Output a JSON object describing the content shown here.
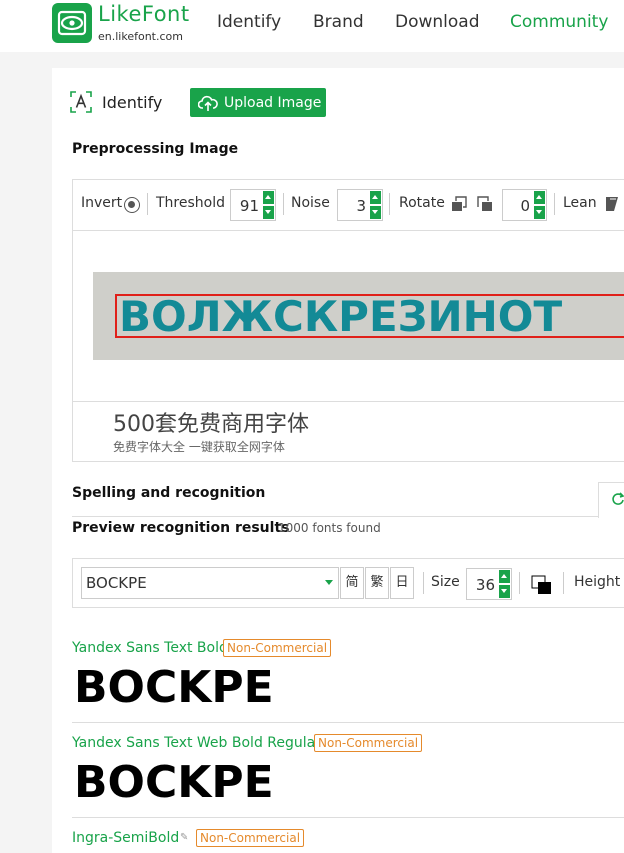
{
  "header": {
    "logo_title": "LikeFont",
    "logo_url": "en.likefont.com",
    "nav": [
      "Identify",
      "Brand",
      "Download",
      "Community"
    ],
    "colors": {
      "brand": "#19a34a",
      "community": "#19a34a"
    }
  },
  "identify": {
    "label": "Identify",
    "upload_label": "Upload Image"
  },
  "preprocessing": {
    "title": "Preprocessing Image",
    "invert_label": "Invert",
    "threshold_label": "Threshold",
    "threshold_value": "91",
    "noise_label": "Noise",
    "noise_value": "3",
    "rotate_label": "Rotate",
    "rotate_value": "0",
    "lean_label": "Lean",
    "image_text": "ВОЛЖСКРЕЗИНОТ"
  },
  "ad": {
    "title": "500套免费商用字体",
    "subtitle": "免费字体大全    一键获取全网字体"
  },
  "spelling": {
    "title": "Spelling and recognition"
  },
  "results": {
    "title": "Preview recognition results",
    "count": "1000 fonts found",
    "text_value": "BOCKPE",
    "cjk_buttons": [
      "简",
      "繁",
      "日"
    ],
    "size_label": "Size",
    "size_value": "36",
    "height_label": "Height",
    "fonts": [
      {
        "name": "Yandex Sans Text Bold",
        "license": "Non-Commercial",
        "sample": "BOCKPE"
      },
      {
        "name": "Yandex Sans Text Web Bold Regular",
        "license": "Non-Commercial",
        "sample": "BOCKPE"
      },
      {
        "name": "Ingra-SemiBold",
        "license": "Non-Commercial"
      }
    ]
  }
}
